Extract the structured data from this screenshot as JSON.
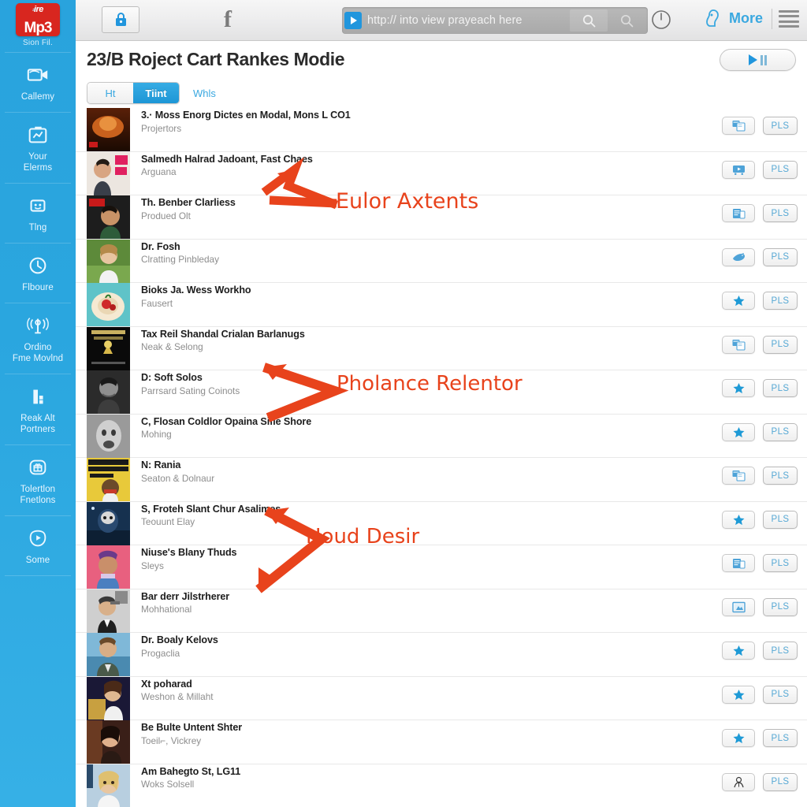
{
  "sidebar": {
    "logo": {
      "top_text": "ire",
      "main_text": "Mp3",
      "caption": "Sion Fil."
    },
    "items": [
      {
        "label": "Callemy",
        "icon": "video-camera-icon"
      },
      {
        "label": "Your\nElerms",
        "label_l1": "Your",
        "label_l2": "Elerms",
        "icon": "briefcase-chart-icon"
      },
      {
        "label": "Tlng",
        "label_l1": "Tlng",
        "label_l2": "",
        "icon": "mail-face-icon"
      },
      {
        "label": "Flboure",
        "label_l1": "Flboure",
        "label_l2": "",
        "icon": "clock-icon"
      },
      {
        "label": "Ordino Fme Movlnd",
        "label_l1": "Ordino",
        "label_l2": "Fme Movlnd",
        "icon": "broadcast-icon"
      },
      {
        "label": "Reak Alt Portners",
        "label_l1": "Reak Alt",
        "label_l2": "Portners",
        "icon": "bar-chart-icon"
      },
      {
        "label": "Tolertlon Fnetlons",
        "label_l1": "Tolertlon",
        "label_l2": "Fnetlons",
        "icon": "shield-gift-icon"
      },
      {
        "label": "Some",
        "label_l1": "Some",
        "label_l2": "",
        "icon": "play-circle-icon"
      }
    ]
  },
  "toolbar": {
    "lock_icon": "lock-icon",
    "f_label": "f",
    "url_value": "http:// into view prayeach here",
    "url_go_icon": "go-arrow-icon",
    "search_icon": "search-icon",
    "clock_icon": "clock-icon",
    "more_label": "More",
    "more_icon": "duck-logo-icon",
    "menu_icon": "hamburger-menu-icon"
  },
  "page": {
    "title": "23/B Roject Cart Rankes Modie",
    "play_button_label": "play-pause",
    "tabs": [
      {
        "label": "Ht",
        "active": false
      },
      {
        "label": "Tiint",
        "active": true
      }
    ],
    "tab_link": "Whls"
  },
  "rows": [
    {
      "title": "3.· Moss Enorg Dictes en Modal, Mons L CO1",
      "sub": "Projertors",
      "action_icon": "document-copy-icon",
      "action_label": "PLS",
      "thumb": "thumb-concert-orange"
    },
    {
      "title": "Salmedh Halrad Jadoant, Fast Chaes",
      "sub": "Arguana",
      "action_icon": "video-player-icon",
      "action_label": "PLS",
      "thumb": "thumb-man-pink"
    },
    {
      "title": "Th. Benber Clarliess",
      "sub": "Produed Olt",
      "action_icon": "folder-doc-icon",
      "action_label": "PLS",
      "thumb": "thumb-man-green"
    },
    {
      "title": "Dr. Fosh",
      "sub": "Clratting Pinbleday",
      "action_icon": "bird-icon",
      "action_label": "PLS",
      "thumb": "thumb-girl-grass"
    },
    {
      "title": "Bioks Ja. Wess Workho",
      "sub": "Fausert",
      "action_icon": "star-icon",
      "action_label": "PLS",
      "thumb": "thumb-food-teal"
    },
    {
      "title": "Tax Reil Shandal Crialan Barlanugs",
      "sub": "Neak & Selong",
      "action_icon": "document-copy-icon",
      "action_label": "PLS",
      "thumb": "thumb-poster-dark"
    },
    {
      "title": "D: Soft Solos",
      "sub": "Parrsard Sating Coinots",
      "action_icon": "star-icon",
      "action_label": "PLS",
      "thumb": "thumb-man-bw"
    },
    {
      "title": "C, Flosan Coldlor Opaina Sifle Shore",
      "sub": "Mohing",
      "action_icon": "star-icon",
      "action_label": "PLS",
      "thumb": "thumb-face-gray"
    },
    {
      "title": "N: Rania",
      "sub": "Seaton & Dolnaur",
      "action_icon": "document-copy-icon",
      "action_label": "PLS",
      "thumb": "thumb-poster-yellow"
    },
    {
      "title": "S, Froteh Slant Chur Asalimes",
      "sub": "Teouunt Elay",
      "action_icon": "star-icon",
      "action_label": "PLS",
      "thumb": "thumb-blue-night"
    },
    {
      "title": "Niuse's Blany Thuds",
      "sub": "Sleys",
      "action_icon": "folder-doc-icon",
      "action_label": "PLS",
      "thumb": "thumb-pink-portrait"
    },
    {
      "title": "Bar derr Jilstrherer",
      "sub": "Mohhational",
      "action_icon": "picture-frame-icon",
      "action_label": "PLS",
      "thumb": "thumb-man-suit"
    },
    {
      "title": "Dr. Boaly Kelovs",
      "sub": "Progaclia",
      "action_icon": "star-icon",
      "action_label": "PLS",
      "thumb": "thumb-man-outdoor"
    },
    {
      "title": "Xt poharad",
      "sub": "Weshon & Millaht",
      "action_icon": "star-icon",
      "action_label": "PLS",
      "thumb": "thumb-woman-stage"
    },
    {
      "title": "Be Bulte Untent Shter",
      "sub": "Toeil⌐, Vickrey",
      "action_icon": "star-icon",
      "action_label": "PLS",
      "thumb": "thumb-woman-dark"
    },
    {
      "title": "Am Bahegto St, LG11",
      "sub": "Woks Solsell",
      "action_icon": "person-sketch-icon",
      "action_label": "PLS",
      "thumb": "thumb-blonde-woman"
    }
  ],
  "annotations": [
    {
      "text": "Eulor Axtents",
      "color": "#e8431c"
    },
    {
      "text": "Pholance Relentor",
      "color": "#e8431c"
    },
    {
      "text": "Houd Desir",
      "color": "#e8431c"
    }
  ],
  "colors": {
    "sidebar": "#2aa6df",
    "accent": "#3aa8e0",
    "logo_red": "#d8261f",
    "annotation": "#e8431c"
  }
}
